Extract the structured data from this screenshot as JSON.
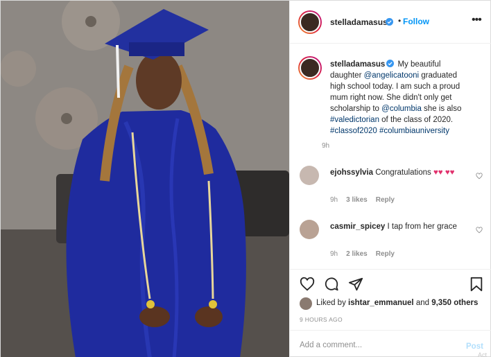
{
  "header": {
    "username": "stelladamasus",
    "follow_label": "Follow",
    "separator": "•",
    "more_icon": "more-options-icon"
  },
  "caption": {
    "username": "stelladamasus",
    "text_1": " My beautiful daughter ",
    "mention_1": "@angelicatooni",
    "text_2": " graduated high school today. I am such a proud mum right now. She didn't only get scholarship to ",
    "mention_2": "@columbia",
    "text_3": " she is also ",
    "hashtag_1": "#valedictorian",
    "text_4": " of the class of 2020. ",
    "hashtag_2": "#classof2020",
    "hashtag_3": "#columbiauniversity",
    "time": "9h"
  },
  "comments": [
    {
      "username": "ejohssylvia",
      "text": " Congratulations ",
      "hearts": "♥♥ ♥♥",
      "time": "9h",
      "likes": "3 likes",
      "reply": "Reply"
    },
    {
      "username": "casmir_spicey",
      "text": " I tap from her grace",
      "time": "9h",
      "likes": "2 likes",
      "reply": "Reply"
    }
  ],
  "likes": {
    "prefix": "Liked by ",
    "user": "ishtar_emmanuel",
    "middle": " and ",
    "count": "9,350 others"
  },
  "timestamp": "9 HOURS AGO",
  "add_comment": {
    "placeholder": "Add a comment...",
    "post_label": "Post",
    "watermark": "Act"
  },
  "colors": {
    "link": "#00376b",
    "follow": "#0095f6",
    "verified": "#3897f0",
    "post_disabled": "#b2dffc",
    "gown": "#1d2a9a"
  },
  "icons": [
    "heart-icon",
    "comment-icon",
    "share-icon",
    "bookmark-icon",
    "verified-badge-icon",
    "small-heart-icon"
  ]
}
